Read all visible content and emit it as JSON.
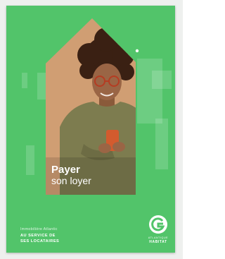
{
  "cover": {
    "title": "Payer",
    "subtitle": "son loyer",
    "tagline_top": "Immobilière Atlantic",
    "tagline_line1": "AU SERVICE DE",
    "tagline_line2": "SES LOCATAIRES",
    "brand_top": "ATLANTIQUE",
    "brand_main": "HABITAT",
    "logo_icon": "brand-g-icon",
    "colors": {
      "background": "#52c46a",
      "text": "#ffffff"
    }
  }
}
